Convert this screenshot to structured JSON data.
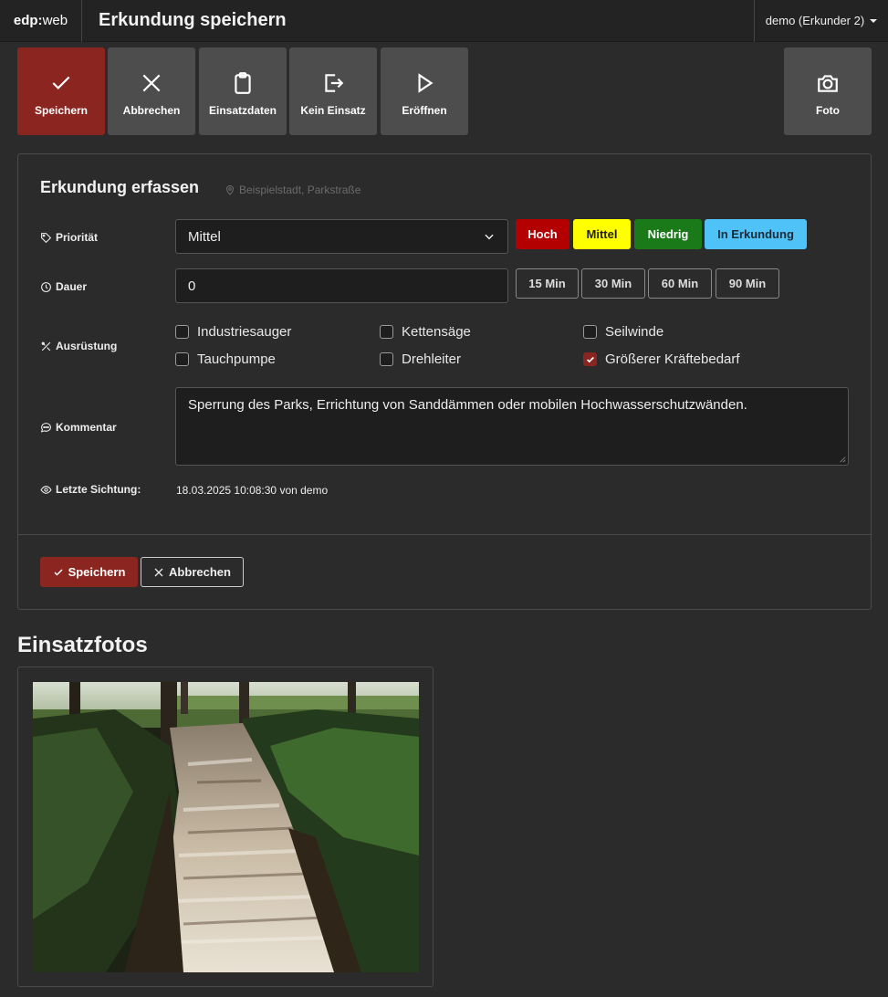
{
  "navbar": {
    "brand_bold": "edp:",
    "brand_rest": "web",
    "title": "Erkundung speichern",
    "user": "demo (Erkunder 2)"
  },
  "toolbar": {
    "save": "Speichern",
    "cancel": "Abbrechen",
    "mission_data": "Einsatzdaten",
    "no_mission": "Kein Einsatz",
    "open": "Eröffnen",
    "photo": "Foto"
  },
  "form": {
    "title": "Erkundung erfassen",
    "location": "Beispielstadt, Parkstraße",
    "priority_label": "Priorität",
    "priority_value": "Mittel",
    "priority_buttons": [
      "Hoch",
      "Mittel",
      "Niedrig",
      "In Erkundung"
    ],
    "priority_colors": {
      "hoch": "#b30000",
      "mittel": "#ffff00",
      "niedrig": "#1a7a1a",
      "erkundung": "#4fc3f7"
    },
    "duration_label": "Dauer",
    "duration_value": "0",
    "duration_buttons": [
      "15 Min",
      "30 Min",
      "60 Min",
      "90 Min"
    ],
    "equipment_label": "Ausrüstung",
    "equipment": [
      {
        "label": "Industriesauger",
        "checked": false
      },
      {
        "label": "Kettensäge",
        "checked": false
      },
      {
        "label": "Seilwinde",
        "checked": false
      },
      {
        "label": "Tauchpumpe",
        "checked": false
      },
      {
        "label": "Drehleiter",
        "checked": false
      },
      {
        "label": "Größerer Kräftebedarf",
        "checked": true
      }
    ],
    "comment_label": "Kommentar",
    "comment_value": "Sperrung des Parks, Errichtung von Sanddämmen oder mobilen Hochwasserschutzwänden.",
    "sight_label": "Letzte Sichtung:",
    "sight_value": "18.03.2025 10:08:30 von demo",
    "save": "Speichern",
    "cancel": "Abbrechen"
  },
  "photos": {
    "title": "Einsatzfotos"
  },
  "colors": {
    "accent": "#8b2520",
    "background": "#2b2b2b",
    "button": "#4d4d4d"
  }
}
